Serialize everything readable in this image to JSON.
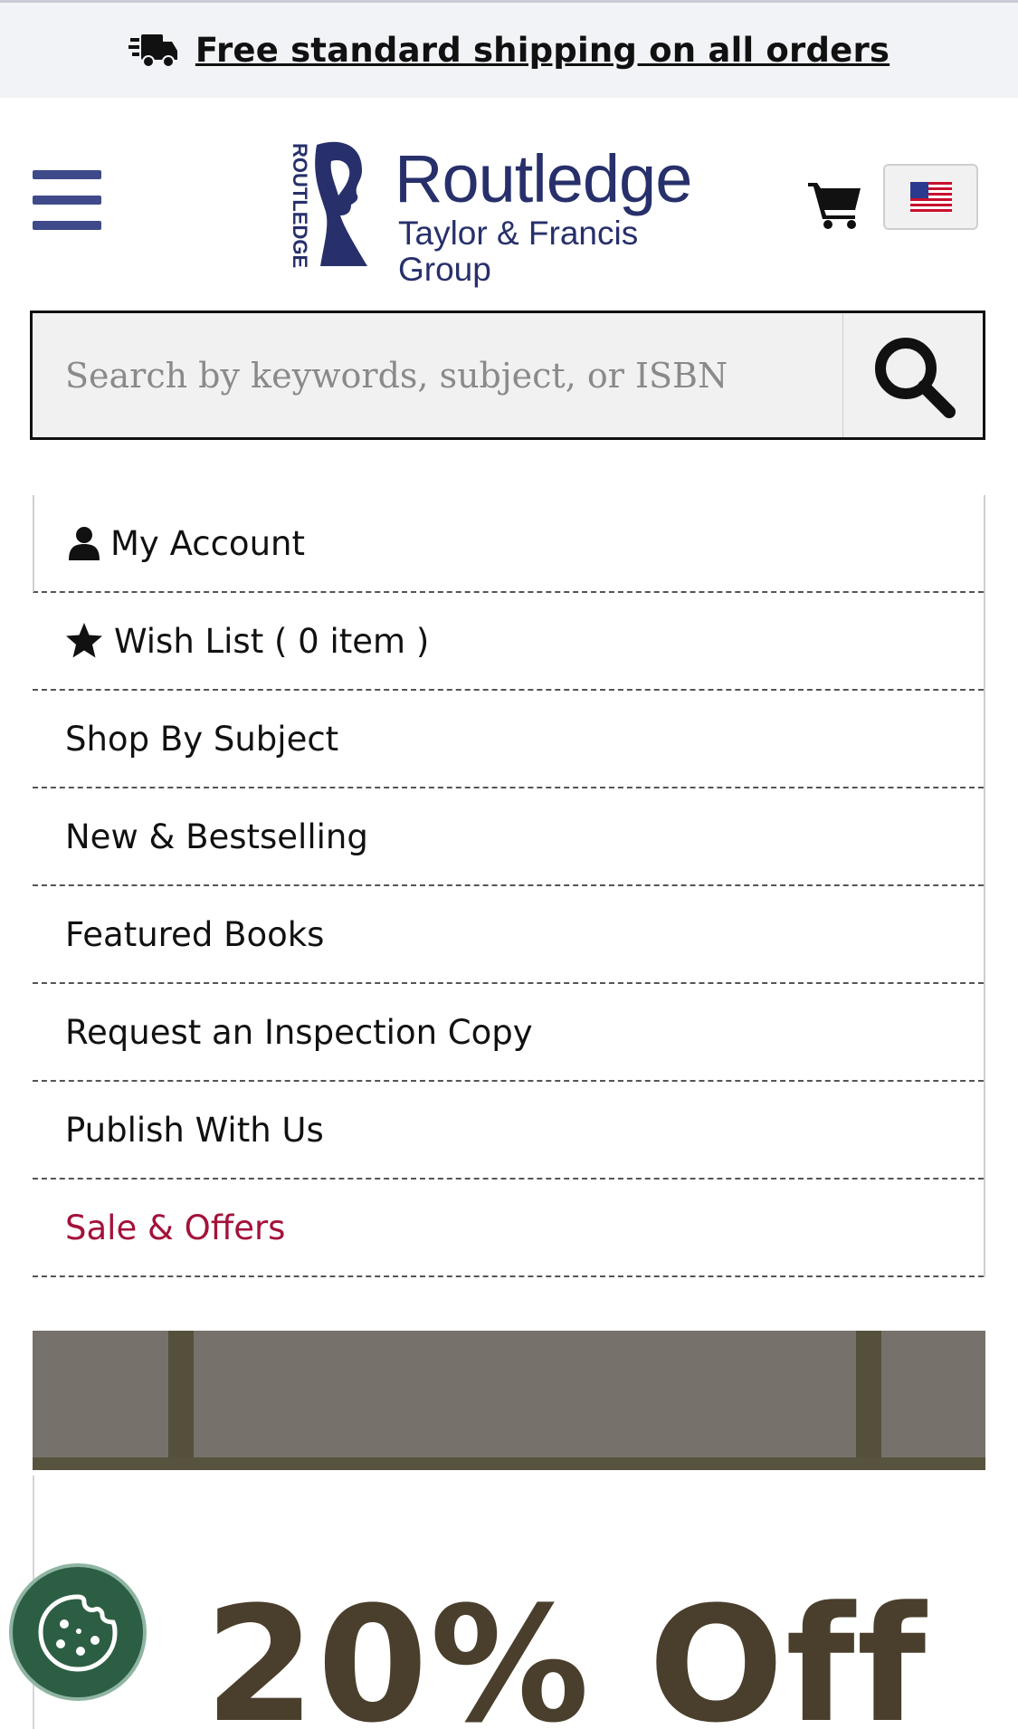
{
  "promo": {
    "text": "Free standard shipping on all orders",
    "icon": "shipping-truck-icon"
  },
  "header": {
    "logo": {
      "brand": "Routledge",
      "subtitle": "Taylor & Francis Group",
      "vertical_mark": "ROUTLEDGE"
    },
    "menu_icon": "hamburger-menu-icon",
    "cart_icon": "shopping-cart-icon",
    "region_flag": "us-flag-icon"
  },
  "search": {
    "placeholder": "Search by keywords, subject, or ISBN",
    "button_icon": "search-icon"
  },
  "menu": {
    "items": [
      {
        "label": "My Account",
        "icon": "user-icon"
      },
      {
        "label": "Wish List ( 0 item )",
        "icon": "star-icon"
      },
      {
        "label": "Shop By Subject"
      },
      {
        "label": "New & Bestselling"
      },
      {
        "label": "Featured Books"
      },
      {
        "label": "Request an Inspection Copy"
      },
      {
        "label": "Publish With Us"
      },
      {
        "label": "Sale & Offers",
        "color": "#a3123a"
      }
    ]
  },
  "banner": {
    "headline": "20% Off"
  },
  "cookie": {
    "icon": "cookie-icon",
    "color": "#2c5e44"
  },
  "colors": {
    "brand": "#27306b",
    "menu_icon": "#3f4a8a",
    "sale": "#a3123a"
  }
}
